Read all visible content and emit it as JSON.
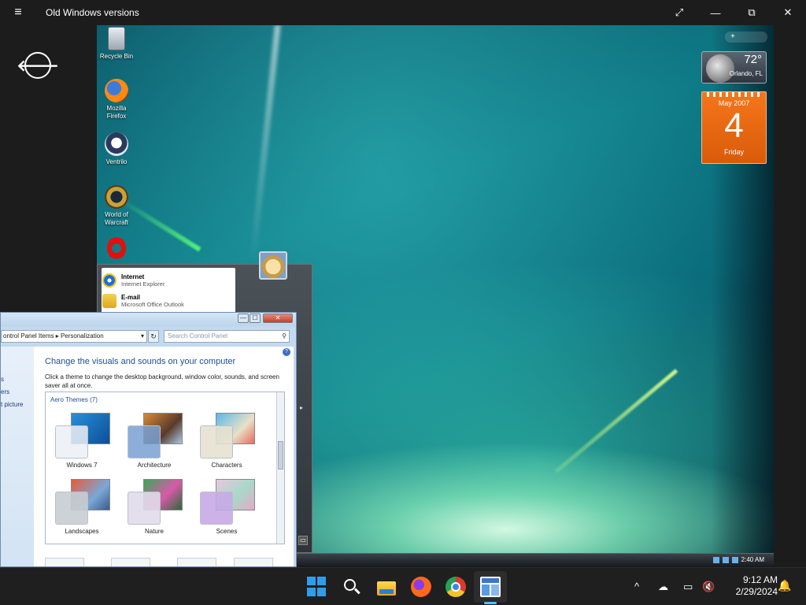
{
  "window": {
    "title": "Old Windows versions",
    "menu_icon": "≡",
    "expand_icon": "⤢",
    "minimize_icon": "—",
    "restore_icon": "⧉",
    "close_icon": "✕",
    "back_icon": "🡐"
  },
  "desktop": {
    "icons": [
      {
        "label": "Recycle Bin",
        "icon": "recycle-bin-icon"
      },
      {
        "label": "Mozilla Firefox",
        "icon": "firefox-icon"
      },
      {
        "label": "Ventrilo",
        "icon": "ventrilo-icon"
      },
      {
        "label": "World of Warcraft",
        "icon": "world-of-warcraft-icon"
      },
      {
        "label": "",
        "icon": "opera-icon"
      }
    ],
    "gadget_bar": "+",
    "weather": {
      "temp": "72°",
      "city": "Orlando, FL"
    },
    "calendar": {
      "month": "May 2007",
      "day": "4",
      "weekday": "Friday"
    },
    "start_menu": {
      "items": [
        {
          "title": "Internet",
          "subtitle": "Internet Explorer"
        },
        {
          "title": "E-mail",
          "subtitle": "Microsoft Office Outlook"
        }
      ],
      "arrow": "▸",
      "small_btn": "▭"
    },
    "vista_taskbar": {
      "clock": "2:40 AM"
    }
  },
  "control_panel": {
    "address": "ontrol Panel Items  ▸  Personalization",
    "address_arrow": "▾",
    "refresh": "↻",
    "search_placeholder": "Search Control Panel",
    "search_icon": "⚲",
    "window_buttons": {
      "min": "—",
      "max": "☐",
      "close": "✕"
    },
    "help": "?",
    "left_pane": [
      "s",
      "ers",
      "t picture"
    ],
    "heading": "Change the visuals and sounds on your computer",
    "description": "Click a theme to change the desktop background, window color, sounds, and screen saver all at once.",
    "group": "Aero Themes (7)",
    "themes": [
      "Windows 7",
      "Architecture",
      "Characters",
      "Landscapes",
      "Nature",
      "Scenes"
    ]
  },
  "taskbar": {
    "clock_time": "9:12 AM",
    "clock_date": "2/29/2024",
    "chevron": "^",
    "onedrive_icon": "☁",
    "network_icon": "▭",
    "volume_icon": "🔇",
    "bell_icon": "🔔"
  },
  "colors": {
    "accent": "#4cc2ff",
    "calendar": "#e8670f",
    "vista_teal": "#0e7a86"
  }
}
